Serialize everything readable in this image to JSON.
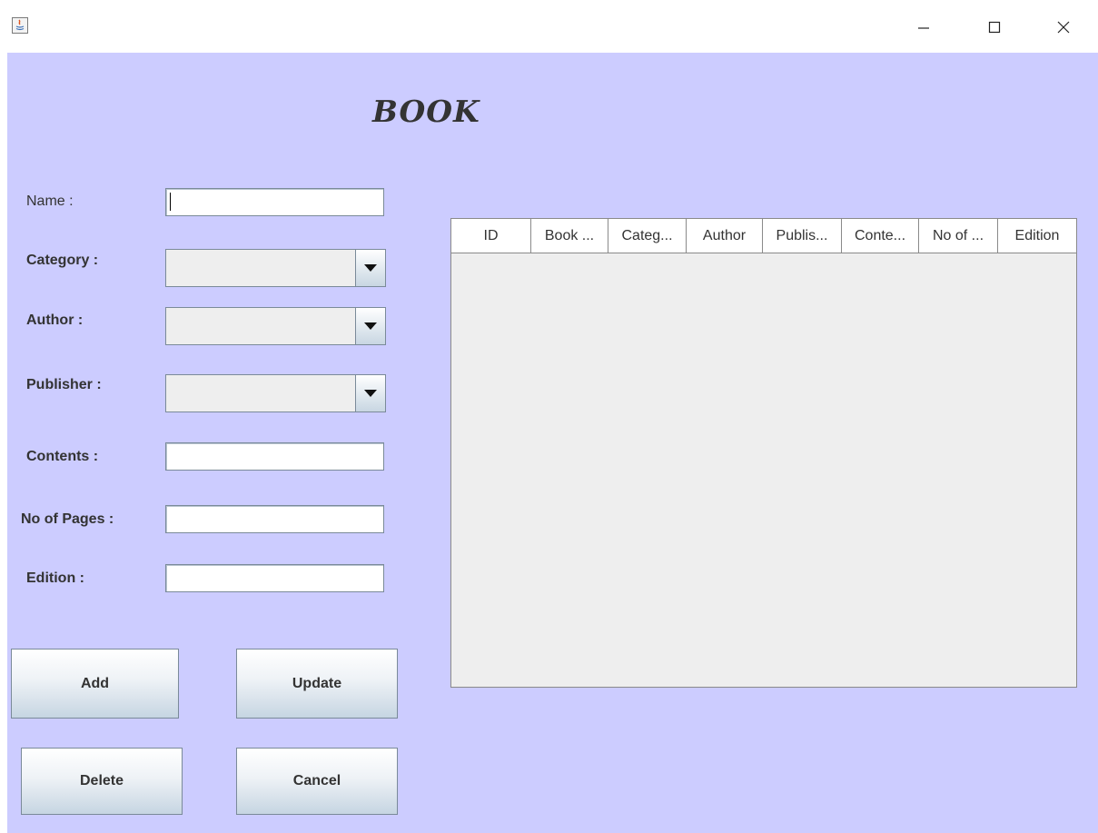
{
  "window": {
    "controls": {
      "minimize": "—",
      "maximize": "☐",
      "close": "✕"
    }
  },
  "form": {
    "title": "BOOK",
    "name_label": "Name :",
    "name_value": "",
    "category_label": "Category :",
    "category_value": "",
    "author_label": "Author :",
    "author_value": "",
    "publisher_label": "Publisher :",
    "publisher_value": "",
    "contents_label": "Contents :",
    "contents_value": "",
    "pages_label": "No of Pages :",
    "pages_value": "",
    "edition_label": "Edition :",
    "edition_value": ""
  },
  "buttons": {
    "add": "Add",
    "update": "Update",
    "delete": "Delete",
    "cancel": "Cancel"
  },
  "table": {
    "columns": [
      "ID",
      "Book ...",
      "Categ...",
      "Author",
      "Publis...",
      "Conte...",
      "No of ...",
      "Edition"
    ],
    "rows": []
  },
  "colors": {
    "panel_background": "#ccccff",
    "table_background": "#eeeeee"
  }
}
